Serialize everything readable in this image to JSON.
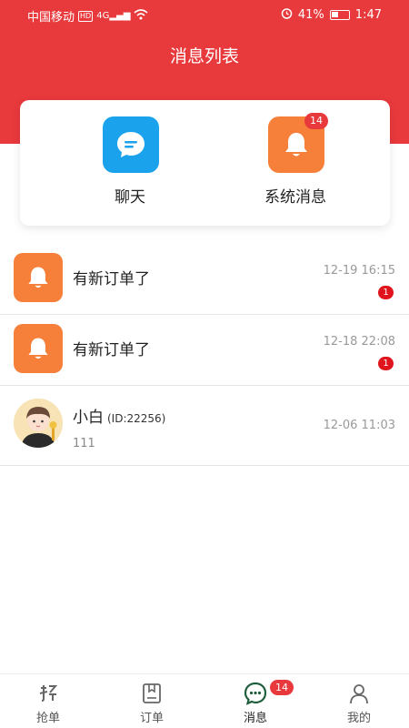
{
  "status_bar": {
    "carrier": "中国移动",
    "hd": "HD",
    "signal": "4G",
    "battery_percent": "41%",
    "time": "1:47"
  },
  "header": {
    "title": "消息列表"
  },
  "categories": [
    {
      "label": "聊天",
      "icon": "chat-bubble-icon",
      "color": "#1aa3ec"
    },
    {
      "label": "系统消息",
      "icon": "bell-icon",
      "color": "#f67f3a",
      "badge": "14"
    }
  ],
  "messages": [
    {
      "title": "有新订单了",
      "time": "12-19 16:15",
      "unread": "1",
      "icon": "bell-icon"
    },
    {
      "title": "有新订单了",
      "time": "12-18 22:08",
      "unread": "1",
      "icon": "bell-icon"
    }
  ],
  "chat": {
    "name": "小白",
    "id_label": "(ID:22256)",
    "last_message": "111",
    "time": "12-06 11:03"
  },
  "tabbar": {
    "items": [
      {
        "label": "抢单",
        "icon": "grab-order-icon"
      },
      {
        "label": "订单",
        "icon": "order-icon"
      },
      {
        "label": "消息",
        "icon": "message-icon",
        "active": true,
        "badge": "14"
      },
      {
        "label": "我的",
        "icon": "profile-icon"
      }
    ]
  },
  "colors": {
    "brand_red": "#e8393d",
    "active_green": "#1f5d3c"
  }
}
